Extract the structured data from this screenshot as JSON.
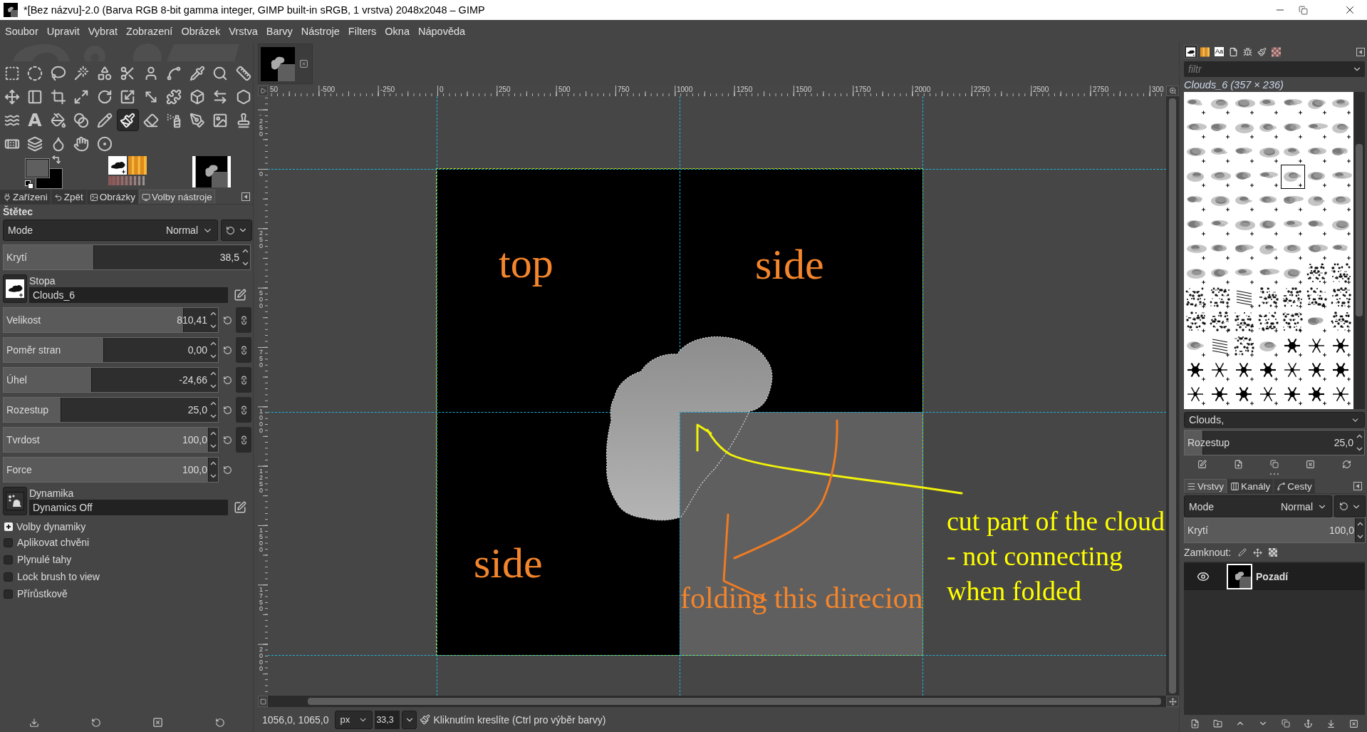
{
  "window": {
    "title": "*[Bez názvu]-2.0 (Barva RGB 8-bit gamma integer, GIMP built-in sRGB, 1 vrstva) 2048x2048 – GIMP"
  },
  "menu": [
    "Soubor",
    "Upravit",
    "Vybrat",
    "Zobrazení",
    "Obrázek",
    "Vrstva",
    "Barvy",
    "Nástroje",
    "Filters",
    "Okna",
    "Nápověda"
  ],
  "toolbox": {
    "tools": [
      {
        "selected": false
      },
      {
        "selected": false
      },
      {
        "selected": false
      },
      {
        "selected": false
      },
      {
        "selected": false
      },
      {
        "selected": false
      },
      {
        "selected": false
      },
      {
        "selected": false
      },
      {
        "selected": false
      },
      {
        "selected": false
      },
      {
        "selected": false
      },
      {
        "selected": false
      },
      {
        "selected": false
      },
      {
        "selected": false
      },
      {
        "selected": false
      },
      {
        "selected": false
      },
      {
        "selected": false
      },
      {
        "selected": false
      },
      {
        "selected": false
      },
      {
        "selected": false
      },
      {
        "selected": false
      },
      {
        "selected": false
      },
      {
        "selected": false
      },
      {
        "label": "A",
        "selected": false
      },
      {
        "selected": false
      },
      {
        "selected": false
      },
      {
        "selected": false
      },
      {
        "selected": true
      },
      {
        "selected": false
      },
      {
        "selected": false
      },
      {
        "selected": false
      },
      {
        "selected": false
      },
      {
        "selected": false
      },
      {
        "selected": false
      },
      {
        "selected": false
      },
      {
        "selected": false
      },
      {
        "selected": false
      },
      {
        "selected": false
      }
    ]
  },
  "left_dock": {
    "tabs": [
      {
        "label": "Zařízeni",
        "selected": false
      },
      {
        "label": "Zpět",
        "selected": false
      },
      {
        "label": "Obrázky",
        "selected": false
      },
      {
        "label": "Volby nástroje",
        "selected": true
      }
    ]
  },
  "tool_options": {
    "title": "Štětec",
    "mode": {
      "label": "Mode",
      "value": "Normal"
    },
    "opacity": {
      "label": "Krytí",
      "value": "38,5",
      "level": 0.38
    },
    "brush": {
      "label": "Stopa",
      "value": "Clouds_6"
    },
    "sliders": [
      {
        "label": "Velikost",
        "value": "810,41",
        "level": 0.88,
        "chain_button": true
      },
      {
        "label": "Poměr stran",
        "value": "0,00",
        "level": 0.49,
        "chain_button": true
      },
      {
        "label": "Úhel",
        "value": "-24,66",
        "level": 0.43,
        "chain_button": true
      },
      {
        "label": "Rozestup",
        "value": "25,0",
        "level": 0.28,
        "chain_button": true
      },
      {
        "label": "Tvrdost",
        "value": "100,0",
        "level": 1,
        "chain_button": true
      },
      {
        "label": "Force",
        "value": "100,0",
        "level": 1,
        "chain_button": false
      }
    ],
    "dynamics": {
      "label": "Dynamika",
      "value": "Dynamics Off"
    },
    "dynamics_options": {
      "label": "Volby dynamiky",
      "expanded": false
    },
    "checkboxes": [
      {
        "label": "Aplikovat chvěni",
        "checked": false
      },
      {
        "label": "Plynulé tahy",
        "checked": false
      },
      {
        "label": "Lock brush to view",
        "checked": false
      },
      {
        "label": "Přírůstkově",
        "checked": false
      }
    ]
  },
  "rulers": {
    "horizontal": [
      "50",
      "-500",
      "-250",
      "0",
      "250",
      "500",
      "750",
      "1000",
      "1250",
      "1500",
      "1750",
      "2000",
      "2250",
      "2500",
      "2750",
      "300"
    ],
    "vertical": [
      "-250",
      "0",
      "250",
      "500",
      "750",
      "1000",
      "1250",
      "1500",
      "1750",
      "2000"
    ]
  },
  "annotations": [
    {
      "lines": [
        "top"
      ],
      "color": "#f3852c"
    },
    {
      "lines": [
        "side"
      ],
      "color": "#f3852c"
    },
    {
      "lines": [
        "side"
      ],
      "color": "#f3852c"
    },
    {
      "lines": [
        "folding this direcion"
      ],
      "color": "#f3852c"
    },
    {
      "lines": [
        "cut part of the cloud",
        "- not connecting",
        "when folded"
      ],
      "color": "#ffff00"
    }
  ],
  "status_bar": {
    "coordinates": "1056,0, 1065,0",
    "unit": "px",
    "zoom": "33,3",
    "message": "Kliknutím kreslíte (Ctrl pro výběr barvy)"
  },
  "brushes_panel": {
    "tabs": [
      {
        "selected": true
      },
      {
        "selected": false
      },
      {
        "label": "Aa",
        "selected": false
      },
      {
        "selected": false
      },
      {
        "selected": false
      },
      {
        "selected": false
      },
      {
        "selected": false
      }
    ],
    "filter": {
      "placeholder": "filtr"
    },
    "info": "Clouds_6 (357 × 236)",
    "brushes": [
      {
        "kind": "cloud",
        "selected": false
      },
      {
        "kind": "cloud",
        "selected": false
      },
      {
        "kind": "cloud",
        "selected": false
      },
      {
        "kind": "cloud",
        "selected": false
      },
      {
        "kind": "cloud",
        "selected": false
      },
      {
        "kind": "cloud",
        "selected": false
      },
      {
        "kind": "cloud",
        "selected": false
      },
      {
        "kind": "cloud",
        "selected": false
      },
      {
        "kind": "cloud",
        "selected": false
      },
      {
        "kind": "cloud",
        "selected": false
      },
      {
        "kind": "cloud",
        "selected": false
      },
      {
        "kind": "cloud",
        "selected": false
      },
      {
        "kind": "cloud",
        "selected": false
      },
      {
        "kind": "cloud",
        "selected": false
      },
      {
        "kind": "cloud",
        "selected": false
      },
      {
        "kind": "cloud",
        "selected": false
      },
      {
        "kind": "cloud",
        "selected": false
      },
      {
        "kind": "cloud",
        "selected": false
      },
      {
        "kind": "cloud",
        "selected": false
      },
      {
        "kind": "cloud",
        "selected": false
      },
      {
        "kind": "cloud",
        "selected": false
      },
      {
        "kind": "cloud",
        "selected": false
      },
      {
        "kind": "cloud",
        "selected": false
      },
      {
        "kind": "cloud",
        "selected": false
      },
      {
        "kind": "cloud",
        "selected": false
      },
      {
        "kind": "cloud",
        "selected": true
      },
      {
        "kind": "cloud",
        "selected": false
      },
      {
        "kind": "cloud",
        "selected": false
      },
      {
        "kind": "cloud",
        "selected": false
      },
      {
        "kind": "cloud",
        "selected": false
      },
      {
        "kind": "cloud",
        "selected": false
      },
      {
        "kind": "cloud",
        "selected": false
      },
      {
        "kind": "cloud",
        "selected": false
      },
      {
        "kind": "cloud",
        "selected": false
      },
      {
        "kind": "cloud",
        "selected": false
      },
      {
        "kind": "cloud",
        "selected": false
      },
      {
        "kind": "cloud",
        "selected": false
      },
      {
        "kind": "cloud",
        "selected": false
      },
      {
        "kind": "cloud",
        "selected": false
      },
      {
        "kind": "cloud",
        "selected": false
      },
      {
        "kind": "cloud",
        "selected": false
      },
      {
        "kind": "cloud",
        "selected": false
      },
      {
        "kind": "cloud",
        "selected": false
      },
      {
        "kind": "cloud",
        "selected": false
      },
      {
        "kind": "cloud",
        "selected": false
      },
      {
        "kind": "cloud",
        "selected": false
      },
      {
        "kind": "cloud",
        "selected": false
      },
      {
        "kind": "cloud",
        "selected": false
      },
      {
        "kind": "cloud",
        "selected": false
      },
      {
        "kind": "cloud",
        "selected": false
      },
      {
        "kind": "cloud",
        "selected": false
      },
      {
        "kind": "cloud",
        "selected": false
      },
      {
        "kind": "cloud",
        "selected": false
      },
      {
        "kind": "cloud",
        "selected": false
      },
      {
        "kind": "speckle",
        "selected": false
      },
      {
        "kind": "speckle",
        "selected": false
      },
      {
        "kind": "speckle",
        "selected": false
      },
      {
        "kind": "speckle",
        "selected": false
      },
      {
        "kind": "lines",
        "selected": false
      },
      {
        "kind": "speckle",
        "selected": false
      },
      {
        "kind": "speckle",
        "selected": false
      },
      {
        "kind": "speckle",
        "selected": false
      },
      {
        "kind": "speckle",
        "selected": false
      },
      {
        "kind": "speckle",
        "selected": false
      },
      {
        "kind": "speckle",
        "selected": false
      },
      {
        "kind": "speckle",
        "selected": false
      },
      {
        "kind": "speckle",
        "selected": false
      },
      {
        "kind": "speckle",
        "selected": false
      },
      {
        "kind": "cloud",
        "selected": false
      },
      {
        "kind": "speckle",
        "selected": false
      },
      {
        "kind": "cloud",
        "selected": false
      },
      {
        "kind": "lines",
        "selected": false
      },
      {
        "kind": "speckle",
        "selected": false
      },
      {
        "kind": "cloud",
        "selected": false
      },
      {
        "kind": "snowflake",
        "selected": false
      },
      {
        "kind": "snowflake",
        "selected": false
      },
      {
        "kind": "snowflake",
        "selected": false
      },
      {
        "kind": "snowflake",
        "selected": false
      },
      {
        "kind": "snowflake",
        "selected": false
      },
      {
        "kind": "snowflake",
        "selected": false
      },
      {
        "kind": "snowflake",
        "selected": false
      },
      {
        "kind": "snowflake",
        "selected": false
      },
      {
        "kind": "snowflake",
        "selected": false
      },
      {
        "kind": "snowflake",
        "selected": false
      },
      {
        "kind": "snowflake",
        "selected": false
      },
      {
        "kind": "snowflake",
        "selected": false
      },
      {
        "kind": "snowflake",
        "selected": false
      },
      {
        "kind": "snowflake",
        "selected": false
      },
      {
        "kind": "snowflake",
        "selected": false
      },
      {
        "kind": "snowflake",
        "selected": false
      },
      {
        "kind": "snowflake",
        "selected": false
      }
    ],
    "tag": "Clouds,",
    "spacing": {
      "label": "Rozestup",
      "value": "25,0",
      "level": 0.11
    }
  },
  "layers_panel": {
    "tabs": [
      {
        "label": "Vrstvy",
        "selected": true
      },
      {
        "label": "Kanály",
        "selected": false
      },
      {
        "label": "Cesty",
        "selected": false
      }
    ],
    "mode": {
      "label": "Mode",
      "value": "Normal"
    },
    "opacity": {
      "label": "Krytí",
      "value": "100,0",
      "level": 1
    },
    "lock_label": "Zamknout:",
    "layers": [
      {
        "name": "Pozadí",
        "visible": true,
        "selected": true
      }
    ]
  }
}
